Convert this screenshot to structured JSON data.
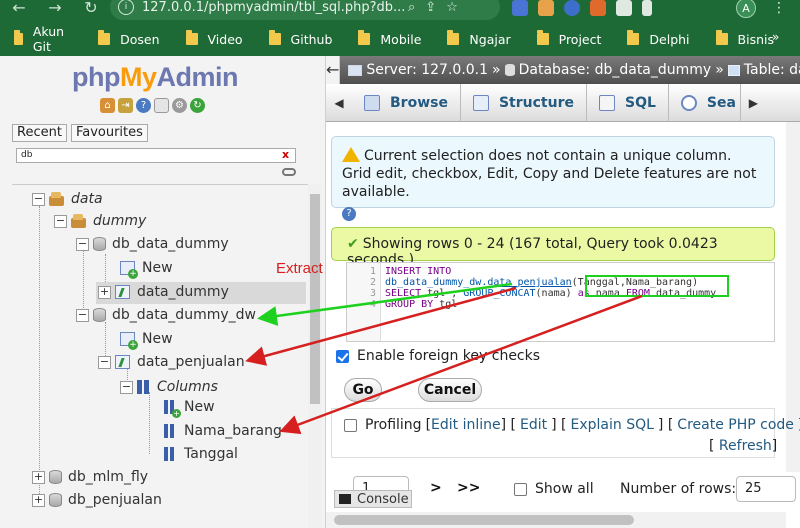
{
  "browser": {
    "url": "127.0.0.1/phpmyadmin/tbl_sql.php?db...",
    "avatar_letter": "A",
    "bookmarks": [
      "Akun Git",
      "Dosen",
      "Video",
      "Github",
      "Mobile",
      "Ngajar",
      "Project",
      "Delphi",
      "Bisnis"
    ],
    "more": "»"
  },
  "sidebar": {
    "logo": {
      "php": "php",
      "my": "My",
      "admin": "Admin"
    },
    "tabs": [
      "Recent",
      "Favourites"
    ],
    "filter_value": "db",
    "tree": {
      "group_data": "data",
      "group_dummy": "dummy",
      "db1": "db_data_dummy",
      "db1_new": "New",
      "db1_table": "data_dummy",
      "db2": "db_data_dummy_dw",
      "db2_new": "New",
      "db2_table": "data_penjualan",
      "columns": "Columns",
      "col_new": "New",
      "col1": "Nama_barang",
      "col2": "Tanggal",
      "db3": "db_mlm_fly",
      "db4": "db_penjualan"
    }
  },
  "main": {
    "breadcrumb": {
      "server": "Server: 127.0.0.1",
      "database": "Database: db_data_dummy",
      "table": "Table: da"
    },
    "tabs": {
      "browse": "Browse",
      "structure": "Structure",
      "sql": "SQL",
      "search": "Sea"
    },
    "notice": "Current selection does not contain a unique column. Grid edit, checkbox, Edit, Copy and Delete features are not available.",
    "success": "Showing rows 0 - 24 (167 total, Query took 0.0423 seconds.)",
    "sql": {
      "gutter": [
        "1",
        "2",
        "3",
        "4"
      ],
      "line1": "INSERT INTO",
      "line2_a": "db_data_dummy_dw.",
      "line2_b": "data_penjualan",
      "line2_c": "(Tanggal,Nama_barang)",
      "line3_a": "SELECT",
      "line3_b": " tgl , ",
      "line3_c": "GROUP_CONCAT",
      "line3_d": "(nama) ",
      "line3_e": "as",
      "line3_f": " nama ",
      "line3_g": "FROM",
      "line3_h": " data_dummy",
      "line4_a": "GROUP BY",
      "line4_b": " tgl"
    },
    "fk_checks": "Enable foreign key checks",
    "go": "Go",
    "cancel": "Cancel",
    "profiling": "Profiling",
    "edit_inline": "Edit inline",
    "edit": "Edit",
    "explain": "Explain SQL",
    "create_php": "Create PHP code",
    "refresh": "Refresh",
    "page_value": "1",
    "next": ">",
    "last": ">>",
    "show_all": "Show all",
    "num_rows_label": "Number of rows:",
    "num_rows_value": "25",
    "console": "Console"
  },
  "annotation": {
    "label": "Extract",
    "color": "#d62020",
    "highlight_color": "#1ed11e"
  }
}
